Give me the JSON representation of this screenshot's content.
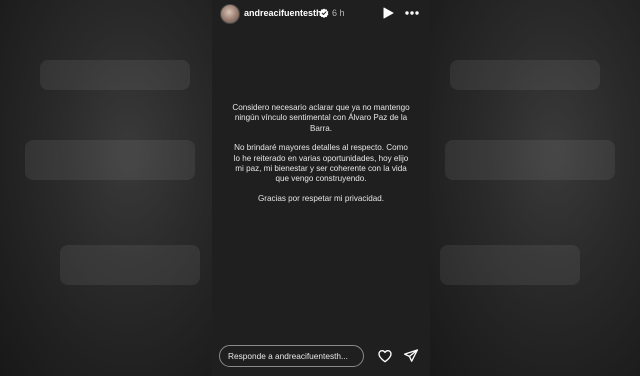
{
  "story": {
    "username": "andreacifuentesth",
    "time_ago": "6 h",
    "message": {
      "paragraph_1": "Considero necesario aclarar que ya no mantengo ningún vínculo sentimental con Álvaro Paz de la Barra.",
      "paragraph_2": "No brindaré mayores detalles al respecto. Como lo he reiterado en varias oportunidades, hoy elijo mi paz, mi bienestar y ser coherente con la vida que vengo construyendo.",
      "paragraph_3": "Gracias por respetar mi privacidad."
    },
    "reply_placeholder": "Responde a andreacifuentesth..."
  },
  "icons": {
    "verified": "verified-badge-icon",
    "play": "play-icon",
    "more": "more-icon",
    "heart": "heart-icon",
    "send": "send-icon"
  },
  "colors": {
    "background": "#1b1b1b",
    "story_background": "#1f1f1f",
    "text": "#e6e6e6",
    "accent": "#ffffff"
  }
}
